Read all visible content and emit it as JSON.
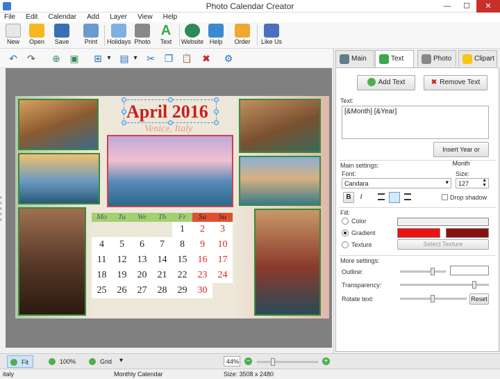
{
  "window": {
    "title": "Photo Calendar Creator",
    "minimize": "—",
    "maximize": "☐",
    "close": "✕"
  },
  "menu": [
    "File",
    "Edit",
    "Calendar",
    "Add",
    "Layer",
    "View",
    "Help"
  ],
  "toolbar": [
    {
      "label": "New",
      "icon": "new-icon",
      "color": "#e8e8e8"
    },
    {
      "label": "Open",
      "icon": "open-folder-icon",
      "color": "#f5b820"
    },
    {
      "label": "Save",
      "icon": "save-disk-icon",
      "color": "#3a6fb8"
    },
    {
      "label": "Print",
      "icon": "printer-icon",
      "color": "#6a9ad0"
    },
    {
      "label": "Holidays",
      "icon": "calendar-holidays-icon",
      "color": "#7fb0e0"
    },
    {
      "label": "Photo",
      "icon": "camera-icon",
      "color": "#888888"
    },
    {
      "label": "Text",
      "icon": "text-a-icon",
      "color": "#3aa84a"
    },
    {
      "label": "Website",
      "icon": "globe-icon",
      "color": "#2a8a5a"
    },
    {
      "label": "Help",
      "icon": "help-book-icon",
      "color": "#3a8ad0"
    },
    {
      "label": "Order",
      "icon": "shopping-bag-icon",
      "color": "#f0a830"
    },
    {
      "label": "Like Us",
      "icon": "thumbs-up-icon",
      "color": "#4a70c0"
    }
  ],
  "toolbar2": [
    {
      "icon": "undo-icon",
      "glyph": "↶"
    },
    {
      "icon": "redo-icon",
      "glyph": "↷"
    },
    {
      "icon": "add-page-icon",
      "glyph": "⊕"
    },
    {
      "icon": "page-settings-icon",
      "glyph": "▣"
    },
    {
      "icon": "align-icon",
      "glyph": "⊞"
    },
    {
      "icon": "align-dropdown-icon",
      "glyph": "▾"
    },
    {
      "icon": "arrange-icon",
      "glyph": "▤"
    },
    {
      "icon": "arrange-dropdown-icon",
      "glyph": "▾"
    },
    {
      "icon": "cut-icon",
      "glyph": "✂"
    },
    {
      "icon": "copy-icon",
      "glyph": "❐"
    },
    {
      "icon": "paste-icon",
      "glyph": "📋"
    },
    {
      "icon": "delete-icon",
      "glyph": "✖"
    },
    {
      "icon": "properties-icon",
      "glyph": "⚙"
    }
  ],
  "calendar": {
    "title": "April 2016",
    "subtitle": "Venice, Italy",
    "weekdays": [
      "Mo",
      "Tu",
      "We",
      "Th",
      "Fr",
      "Sa",
      "Su"
    ],
    "weeks": [
      [
        "",
        "",
        "",
        "",
        "1",
        "2",
        "3"
      ],
      [
        "4",
        "5",
        "6",
        "7",
        "8",
        "9",
        "10"
      ],
      [
        "11",
        "12",
        "13",
        "14",
        "15",
        "16",
        "17"
      ],
      [
        "18",
        "19",
        "20",
        "21",
        "22",
        "23",
        "24"
      ],
      [
        "25",
        "26",
        "27",
        "28",
        "29",
        "30",
        ""
      ]
    ],
    "title_color": "#c81e1e",
    "weekend_color": "#e02020"
  },
  "panel": {
    "tabs": [
      {
        "label": "Main",
        "icon": "main-tab-icon",
        "color": "#607d8b"
      },
      {
        "label": "Text",
        "icon": "text-tab-icon",
        "color": "#3aa84a"
      },
      {
        "label": "Photo",
        "icon": "photo-tab-icon",
        "color": "#888888"
      },
      {
        "label": "Clipart",
        "icon": "clipart-star-icon",
        "color": "#f5c518"
      }
    ],
    "add_text": "Add Text",
    "remove_text": "Remove Text",
    "text_label": "Text:",
    "text_value": "[&Month] [&Year]",
    "insert_year_month": "Insert Year or Month",
    "main_settings": "Main settings:",
    "font_label": "Font:",
    "font_value": "Candara",
    "size_label": "Size:",
    "size_value": "127",
    "bold": "B",
    "italic": "I",
    "drop_shadow": "Drop shadow",
    "fill_label": "Fill:",
    "color_option": "Color",
    "gradient_option": "Gradient",
    "texture_option": "Texture",
    "select_texture": "Select Texture",
    "gradient_color1": "#ee1111",
    "gradient_color2": "#8a1010",
    "more_settings": "More settings:",
    "outline_label": "Outline:",
    "transparency_label": "Transparency:",
    "rotate_label": "Rotate text:",
    "reset": "Reset"
  },
  "status": {
    "fit": "Fit",
    "zoom100": "100%",
    "grid": "Grid",
    "zoom_value": "44%",
    "left": "italy",
    "middle": "Monthly Calendar",
    "size": "Size: 3508 x 2480"
  }
}
